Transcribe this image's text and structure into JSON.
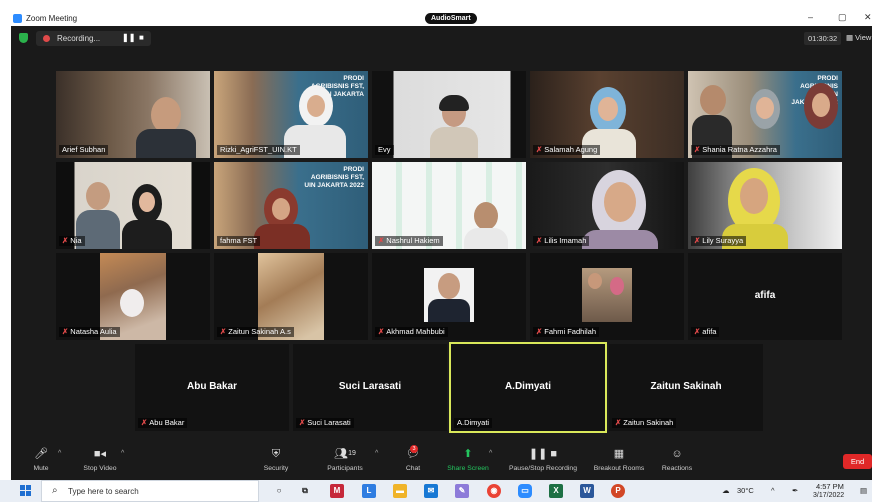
{
  "window": {
    "title": "Zoom Meeting",
    "audiosmart": "AudioSmart",
    "minimize": "–",
    "maximize": "▢",
    "close": "✕"
  },
  "topbar": {
    "recording_label": "Recording...",
    "pause_icon": "❚❚",
    "stop_icon": "■",
    "timer": "01:30:32",
    "view_label": "View"
  },
  "participants": [
    {
      "name": "Arief Subhan",
      "muted": false
    },
    {
      "name": "Rizki_AgriFST_UIN.KT",
      "muted": false
    },
    {
      "name": "Evy",
      "muted": false
    },
    {
      "name": "Salamah Agung",
      "muted": true
    },
    {
      "name": "Shania Ratna Azzahra",
      "muted": true
    },
    {
      "name": "Nia",
      "muted": true
    },
    {
      "name": "fahma FST",
      "muted": false
    },
    {
      "name": "Nashrul Hakiem",
      "muted": true
    },
    {
      "name": "Lilis Imamah",
      "muted": true
    },
    {
      "name": "Lily Surayya",
      "muted": true
    },
    {
      "name": "Natasha Aulia",
      "muted": true
    },
    {
      "name": "Zaitun Sakinah A.s",
      "muted": true
    },
    {
      "name": "Akhmad Mahbubi",
      "muted": true
    },
    {
      "name": "Fahmi Fadhilah",
      "muted": true
    },
    {
      "name": "afifa",
      "muted": true,
      "big": "afifa"
    },
    {
      "name": "Abu Bakar",
      "muted": true,
      "big": "Abu Bakar"
    },
    {
      "name": "Suci Larasati",
      "muted": true,
      "big": "Suci Larasati"
    },
    {
      "name": "A.Dimyati",
      "muted": false,
      "big": "A.Dimyati"
    },
    {
      "name": "Zaitun Sakinah",
      "muted": true,
      "big": "Zaitun Sakinah"
    }
  ],
  "posters": {
    "rizki": "PRODI AGRIBISNIS FST, UIN JAKARTA",
    "fahma": "PRODI AGRIBISNIS FST, UIN JAKARTA 2022",
    "shania": "PRODI AGRIBISNIS FST, UIN JAKARTA 2022"
  },
  "toolbar": {
    "mute": "Mute",
    "stop_video": "Stop Video",
    "security": "Security",
    "participants": "Participants",
    "participants_count": "19",
    "chat": "Chat",
    "chat_badge": "3",
    "share_screen": "Share Screen",
    "pause_recording": "Pause/Stop Recording",
    "breakout": "Breakout Rooms",
    "reactions": "Reactions",
    "end": "End"
  },
  "taskbar": {
    "search_placeholder": "Type here to search",
    "temperature": "30°C",
    "time": "4:57 PM",
    "date": "3/17/2022"
  },
  "colors": {
    "active_speaker_border": "#d9e85a",
    "end_button": "#e02828",
    "share_green": "#23c55e",
    "zoom_blue": "#2d8cff"
  }
}
